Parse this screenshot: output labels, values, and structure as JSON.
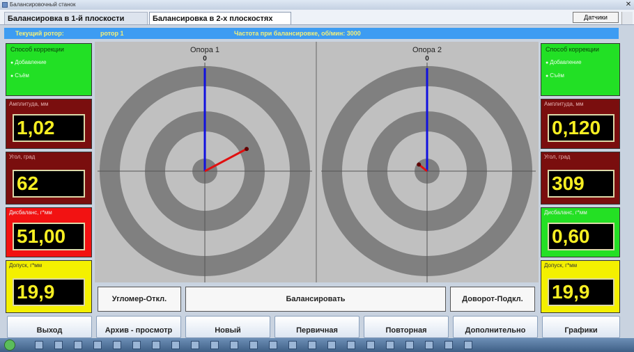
{
  "window": {
    "title": "Балансировочный станок"
  },
  "tabs": [
    {
      "label": "Балансировка в 1-й плоскости",
      "active": false
    },
    {
      "label": "Балансировка в 2-х плоскостях",
      "active": true
    }
  ],
  "header": {
    "sensors_button": "Датчики"
  },
  "info": {
    "current_rotor_label": "Текущий ротор:",
    "current_rotor_value": "ротор 1",
    "frequency_text": "Частота при балансировке, об/мин: 3000"
  },
  "left": {
    "correction": {
      "title": "Способ коррекции",
      "options": [
        "Добавление",
        "Съём"
      ]
    },
    "amplitude": {
      "label": "Амплитуда, мм",
      "value": "1,02"
    },
    "phase": {
      "label": "Угол, град",
      "value": "62"
    },
    "imbalance": {
      "label": "Дисбаланс, г*мм",
      "value": "51,00"
    },
    "tolerance": {
      "label": "Допуск, г*мм",
      "value": "19,9"
    }
  },
  "right": {
    "correction": {
      "title": "Способ коррекции",
      "options": [
        "Добавление",
        "Съём"
      ]
    },
    "amplitude": {
      "label": "Амплитуда, мм",
      "value": "0,120"
    },
    "phase": {
      "label": "Угол, град",
      "value": "309"
    },
    "imbalance": {
      "label": "Дисбаланс, г*мм",
      "value": "0,60"
    },
    "tolerance": {
      "label": "Допуск, г*мм",
      "value": "19,9"
    }
  },
  "targets": [
    {
      "label": "Опора 1",
      "zero_label": "0",
      "vector_angle_deg": 62,
      "vector_magnitude": 0.45
    },
    {
      "label": "Опора 2",
      "zero_label": "0",
      "vector_angle_deg": 309,
      "vector_magnitude": 0.1
    }
  ],
  "actions": {
    "angle_meter": "Угломер-Откл.",
    "balance": "Балансировать",
    "turn": "Доворот-Подкл."
  },
  "bottom_buttons": [
    "Выход",
    "Архив - просмотр",
    "Новый",
    "Первичная",
    "Повторная",
    "Дополнительно",
    "Графики"
  ],
  "colors": {
    "accent_blue": "#3d9cf2",
    "panel_green": "#22e025",
    "panel_red": "#f21212",
    "panel_dark_red": "#7a0e0e",
    "panel_yellow": "#f4f000",
    "value_text": "#f6ee22"
  }
}
